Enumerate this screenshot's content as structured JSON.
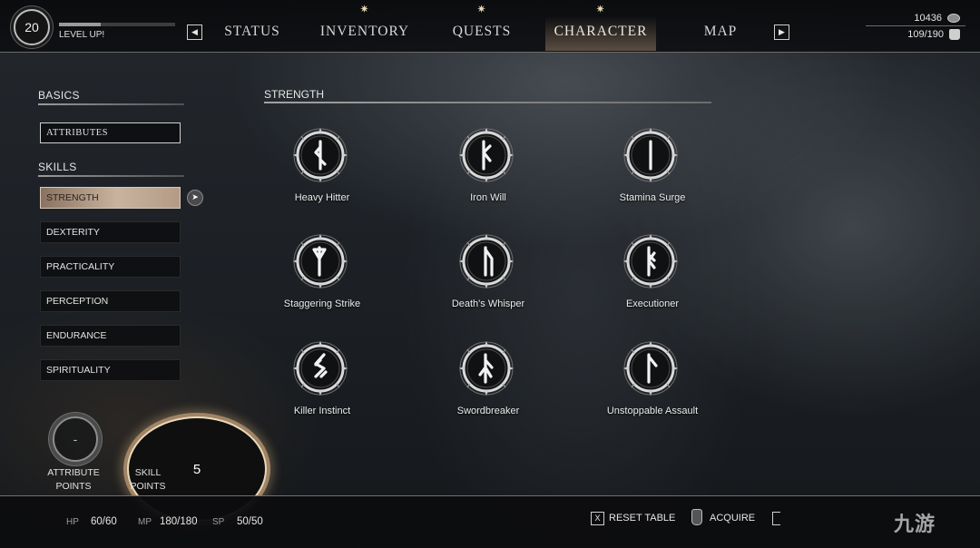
{
  "header": {
    "level": "20",
    "level_up_label": "LEVEL UP!",
    "xp_progress": 0.36,
    "tabs": [
      {
        "label": "STATUS",
        "star": ""
      },
      {
        "label": "INVENTORY",
        "star": "✷"
      },
      {
        "label": "QUESTS",
        "star": "✷"
      },
      {
        "label": "CHARACTER",
        "star": "✷"
      },
      {
        "label": "MAP",
        "star": ""
      }
    ],
    "active_tab": "CHARACTER",
    "prev_arrow": "◀",
    "next_arrow": "▶",
    "currency": "10436",
    "carry_weight": "109/190"
  },
  "sidebar": {
    "basics_title": "BASICS",
    "attributes_label": "ATTRIBUTES",
    "skills_title": "SKILLS",
    "skills": [
      {
        "label": "STRENGTH"
      },
      {
        "label": "DEXTERITY"
      },
      {
        "label": "PRACTICALITY"
      },
      {
        "label": "PERCEPTION"
      },
      {
        "label": "ENDURANCE"
      },
      {
        "label": "SPIRITUALITY"
      }
    ],
    "selected_skill": "STRENGTH",
    "pointer_glyph": "➤",
    "attribute_points": {
      "value": "-",
      "label_line1": "ATTRIBUTE",
      "label_line2": "POINTS"
    },
    "skill_points": {
      "value": "5",
      "label_line1": "SKILL",
      "label_line2": "POINTS"
    }
  },
  "grid": {
    "title": "STRENGTH",
    "skills": [
      {
        "name": "Heavy Hitter",
        "icon": "rune-heavy-hitter-icon"
      },
      {
        "name": "Iron Will",
        "icon": "rune-iron-will-icon"
      },
      {
        "name": "Stamina Surge",
        "icon": "rune-stamina-surge-icon"
      },
      {
        "name": "Staggering Strike",
        "icon": "rune-staggering-strike-icon"
      },
      {
        "name": "Death's Whisper",
        "icon": "rune-deaths-whisper-icon"
      },
      {
        "name": "Executioner",
        "icon": "rune-executioner-icon"
      },
      {
        "name": "Killer Instinct",
        "icon": "rune-killer-instinct-icon"
      },
      {
        "name": "Swordbreaker",
        "icon": "rune-swordbreaker-icon"
      },
      {
        "name": "Unstoppable Assault",
        "icon": "rune-unstoppable-assault-icon"
      }
    ]
  },
  "footer": {
    "hp_label": "HP",
    "hp_value": "60/60",
    "mp_label": "MP",
    "mp_value": "180/180",
    "sp_label": "SP",
    "sp_value": "50/50",
    "reset_key": "X",
    "reset_label": "RESET TABLE",
    "acquire_label": "ACQUIRE"
  },
  "watermark": "九游"
}
